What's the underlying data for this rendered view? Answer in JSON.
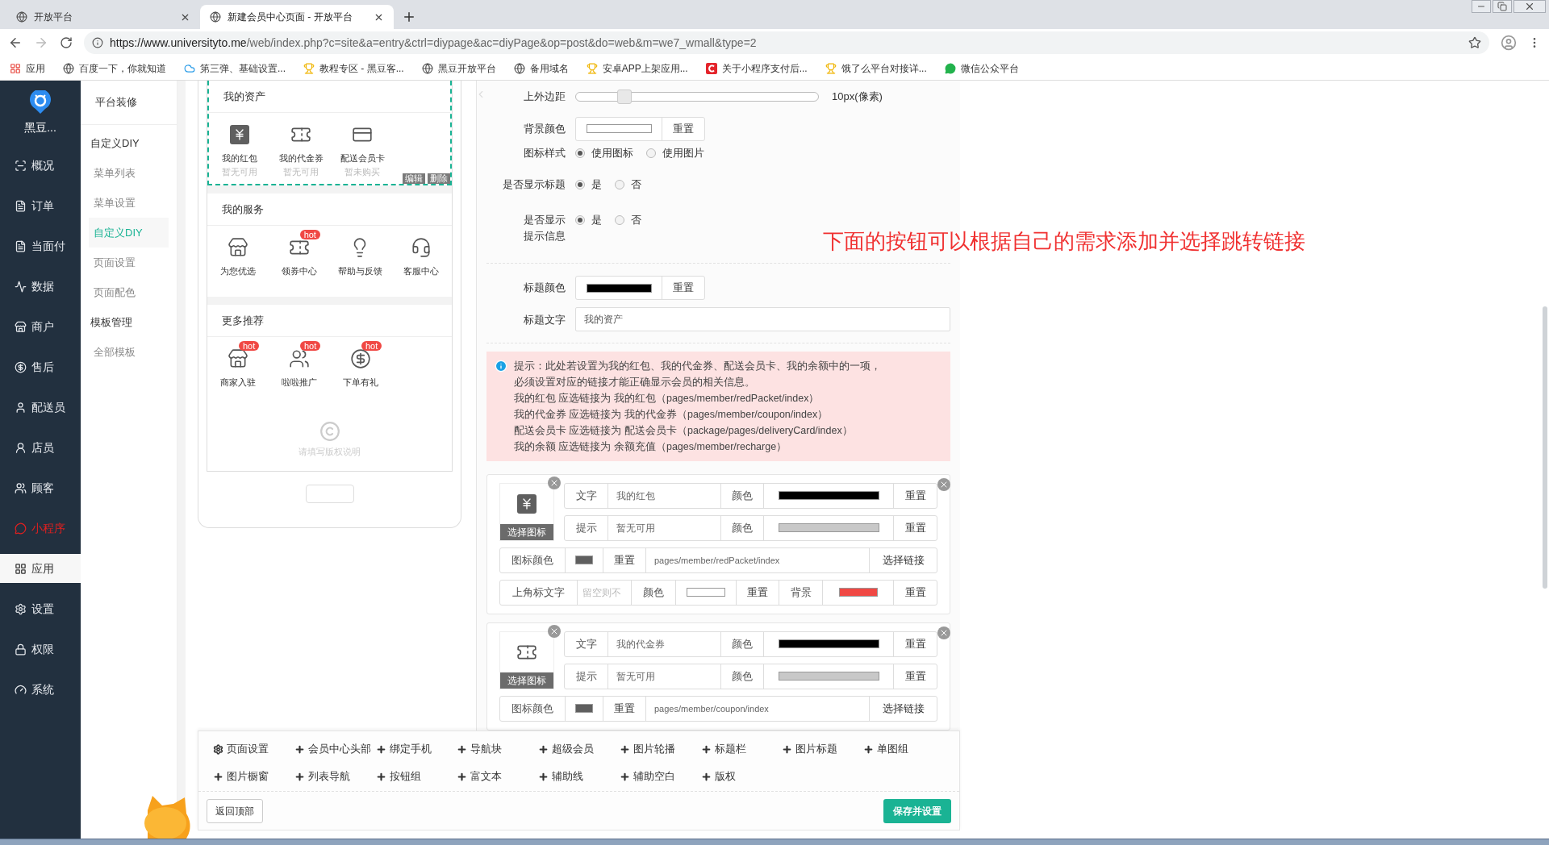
{
  "browser": {
    "tabs": [
      {
        "title": "开放平台",
        "selected": false
      },
      {
        "title": "新建会员中心页面 - 开放平台",
        "selected": true
      }
    ],
    "url_host": "https://www.universityto.me",
    "url_path": "/web/index.php?c=site&a=entry&ctrl=diypage&ac=diyPage&op=post&do=web&m=we7_wmall&type=2",
    "bookmarks": [
      "应用",
      "百度一下，你就知道",
      "第三弹、基础设置...",
      "教程专区 - 黑豆客...",
      "黑豆开放平台",
      "备用域名",
      "安卓APP上架应用...",
      "关于小程序支付后...",
      "饿了么平台对接详...",
      "微信公众平台"
    ]
  },
  "sidebar": {
    "brand": "黑豆...",
    "items": [
      {
        "label": "概况",
        "kind": "normal",
        "selected": false
      },
      {
        "label": "订单",
        "kind": "normal",
        "selected": false
      },
      {
        "label": "当面付",
        "kind": "normal",
        "selected": false
      },
      {
        "label": "数据",
        "kind": "normal",
        "selected": false
      },
      {
        "label": "商户",
        "kind": "normal",
        "selected": false
      },
      {
        "label": "售后",
        "kind": "normal",
        "selected": false
      },
      {
        "label": "配送员",
        "kind": "normal",
        "selected": false
      },
      {
        "label": "店员",
        "kind": "normal",
        "selected": false
      },
      {
        "label": "顾客",
        "kind": "normal",
        "selected": false
      },
      {
        "label": "小程序",
        "kind": "accent",
        "selected": false
      },
      {
        "label": "应用",
        "kind": "normal",
        "selected": true
      },
      {
        "label": "设置",
        "kind": "normal",
        "selected": false
      },
      {
        "label": "权限",
        "kind": "normal",
        "selected": false
      },
      {
        "label": "系统",
        "kind": "normal",
        "selected": false
      }
    ]
  },
  "subnav": {
    "title": "平台装修",
    "groups": [
      {
        "label": "自定义DIY",
        "items": [
          {
            "label": "菜单列表",
            "selected": false
          },
          {
            "label": "菜单设置",
            "selected": false
          },
          {
            "label": "自定义DIY",
            "selected": true
          },
          {
            "label": "页面设置",
            "selected": false
          },
          {
            "label": "页面配色",
            "selected": false
          }
        ]
      },
      {
        "label": "模板管理",
        "items": [
          {
            "label": "全部模板",
            "selected": false
          }
        ]
      }
    ]
  },
  "preview": {
    "actions": [
      "编辑",
      "删除"
    ],
    "copyright": "请填写版权说明",
    "sections": [
      {
        "title": "我的资产",
        "selected": true,
        "items": [
          {
            "label": "我的红包",
            "hint": "暂无可用"
          },
          {
            "label": "我的代金券",
            "hint": "暂无可用"
          },
          {
            "label": "配送会员卡",
            "hint": "暂未购买"
          }
        ]
      },
      {
        "title": "我的服务",
        "selected": false,
        "items": [
          {
            "label": "为您优选"
          },
          {
            "label": "领券中心",
            "badge": "hot"
          },
          {
            "label": "帮助与反馈"
          },
          {
            "label": "客服中心"
          }
        ]
      },
      {
        "title": "更多推荐",
        "selected": false,
        "items": [
          {
            "label": "商家入驻",
            "badge": "hot"
          },
          {
            "label": "啦啦推广",
            "badge": "hot"
          },
          {
            "label": "下单有礼",
            "badge": "hot"
          }
        ]
      }
    ]
  },
  "settings": {
    "margin": {
      "label": "上外边距",
      "level": 0.2,
      "reading": "10px(像素)"
    },
    "bg_color": {
      "label": "背景颜色",
      "color": "#ffffff",
      "reset": "重置"
    },
    "radios": [
      {
        "label_lines": [
          "图标样式"
        ],
        "options": [
          {
            "label": "使用图标",
            "selected": true
          },
          {
            "label": "使用图片",
            "selected": false
          }
        ]
      },
      {
        "label_lines": [
          "是否显示标题"
        ],
        "options": [
          {
            "label": "是",
            "selected": true
          },
          {
            "label": "否",
            "selected": false
          }
        ]
      },
      {
        "label_lines": [
          "是否显示",
          "提示信息"
        ],
        "options": [
          {
            "label": "是",
            "selected": true
          },
          {
            "label": "否",
            "selected": false
          }
        ]
      }
    ],
    "title_color": {
      "label": "标题颜色",
      "color": "#000000",
      "reset": "重置"
    },
    "title_text": {
      "label": "标题文字",
      "value": "我的资产"
    },
    "tip": [
      "提示：此处若设置为我的红包、我的代金券、配送会员卡、我的余额中的一项，",
      "必须设置对应的链接才能正确显示会员的相关信息。",
      "我的红包 应选链接为 我的红包（pages/member/redPacket/index）",
      "我的代金券 应选链接为 我的代金券（pages/member/coupon/index）",
      "配送会员卡 应选链接为 配送会员卡（package/pages/deliveryCard/index）",
      "我的余额 应选链接为 余额充值（pages/member/recharge）"
    ],
    "cards": [
      {
        "icon_button": "选择图标",
        "text_label": "文字",
        "text_value": "我的红包",
        "text_color_label": "颜色",
        "text_swatch": {
          "color": "#000000"
        },
        "text_reset": "重置",
        "hint_label": "提示",
        "hint_value": "暂无可用",
        "hint_color_label": "颜色",
        "hint_swatch": {
          "color": "#c8c8c8"
        },
        "hint_reset": "重置",
        "icon_color_label": "图标颜色",
        "icon_swatch": {
          "color": "#5f5f5f"
        },
        "icon_reset": "重置",
        "link": "pages/member/redPacket/index",
        "link_button": "选择链接",
        "badge_label": "上角标文字",
        "badge_placeholder": "留空则不",
        "badge_color_label": "颜色",
        "badge_swatch": {
          "color": "#ffffff"
        },
        "badge_reset": "重置",
        "badge_bg_label": "背景",
        "badge_bg_swatch": {
          "color": "#f04844"
        },
        "badge_bg_reset": "重置"
      },
      {
        "icon_button": "选择图标",
        "text_label": "文字",
        "text_value": "我的代金券",
        "text_color_label": "颜色",
        "text_swatch": {
          "color": "#000000"
        },
        "text_reset": "重置",
        "hint_label": "提示",
        "hint_value": "暂无可用",
        "hint_color_label": "颜色",
        "hint_swatch": {
          "color": "#c8c8c8"
        },
        "hint_reset": "重置",
        "icon_color_label": "图标颜色",
        "icon_swatch": {
          "color": "#5f5f5f"
        },
        "icon_reset": "重置",
        "link": "pages/member/coupon/index",
        "link_button": "选择链接"
      }
    ]
  },
  "annotation": "下面的按钮可以根据自己的需求添加并选择跳转链接",
  "toolbar": {
    "buttons": [
      {
        "label": "页面设置",
        "kind": "settings"
      },
      {
        "label": "会员中心头部",
        "kind": "add"
      },
      {
        "label": "绑定手机",
        "kind": "add"
      },
      {
        "label": "导航块",
        "kind": "add"
      },
      {
        "label": "超级会员",
        "kind": "add"
      },
      {
        "label": "图片轮播",
        "kind": "add"
      },
      {
        "label": "标题栏",
        "kind": "add"
      },
      {
        "label": "图片标题",
        "kind": "add"
      },
      {
        "label": "单图组",
        "kind": "add"
      },
      {
        "label": "图片橱窗",
        "kind": "add"
      },
      {
        "label": "列表导航",
        "kind": "add"
      },
      {
        "label": "按钮组",
        "kind": "add"
      },
      {
        "label": "富文本",
        "kind": "add"
      },
      {
        "label": "辅助线",
        "kind": "add"
      },
      {
        "label": "辅助空白",
        "kind": "add"
      },
      {
        "label": "版权",
        "kind": "add"
      }
    ],
    "back_top": "返回顶部",
    "save": "保存并设置"
  }
}
